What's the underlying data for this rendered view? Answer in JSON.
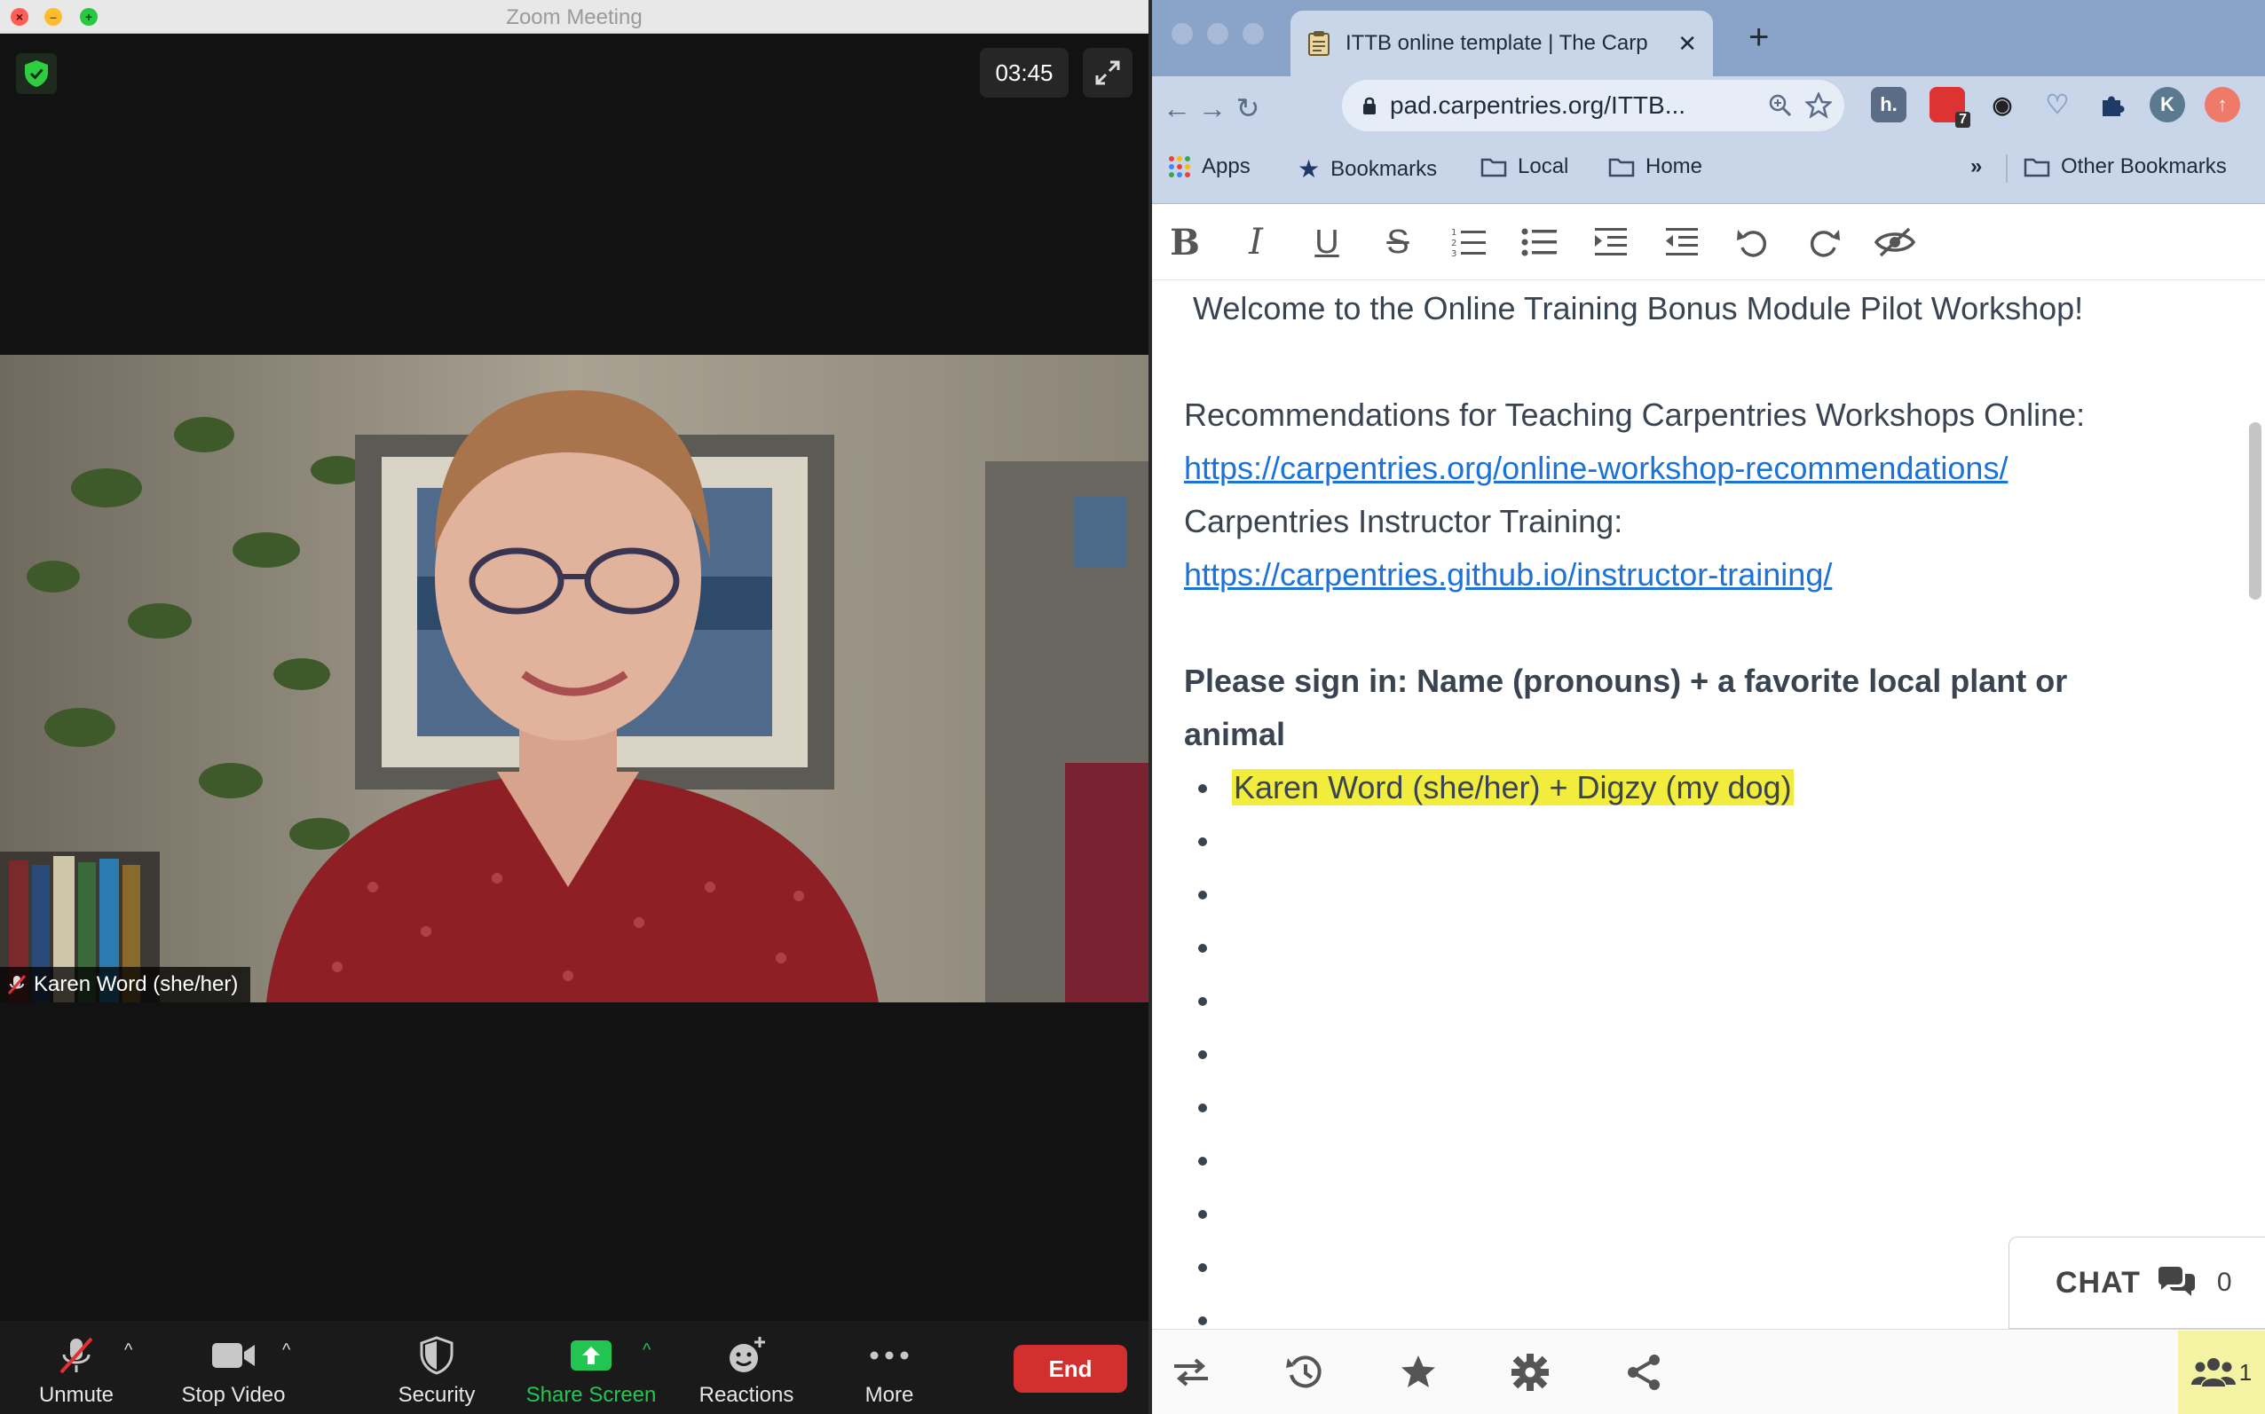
{
  "zoom": {
    "window_title": "Zoom Meeting",
    "timer": "03:45",
    "participant_name": "Karen Word (she/her)",
    "toolbar": {
      "unmute": "Unmute",
      "stop_video": "Stop Video",
      "security": "Security",
      "share_screen": "Share Screen",
      "reactions": "Reactions",
      "more": "More",
      "end": "End"
    },
    "colors": {
      "end": "#d42f2f",
      "share": "#23c552",
      "shield": "#2ecc40"
    }
  },
  "browser": {
    "tab_title": "ITTB online template | The Carp",
    "url": "pad.carpentries.org/ITTB...",
    "extension_badge": "7",
    "profile_initial": "K",
    "extension_letter": "h.",
    "bookmarks": {
      "apps": "Apps",
      "bookmarks": "Bookmarks",
      "local": "Local",
      "home": "Home",
      "overflow": "»",
      "other": "Other Bookmarks"
    }
  },
  "pad": {
    "welcome": "Welcome to the Online Training Bonus Module Pilot Workshop!",
    "rec_label": "Recommendations for Teaching Carpentries Workshops Online:",
    "rec_link": "https://carpentries.org/online-workshop-recommendations/",
    "instr_label": "Carpentries Instructor Training:",
    "instr_link": "https://carpentries.github.io/instructor-training/",
    "signin_line1": "Please sign in: Name (pronouns) + a favorite local plant or",
    "signin_line2": "animal",
    "first_entry": "Karen Word (she/her) + Digzy (my dog)",
    "chat_label": "CHAT",
    "chat_count": "0",
    "users_count": "1",
    "highlight_color": "#f2ec3c"
  }
}
